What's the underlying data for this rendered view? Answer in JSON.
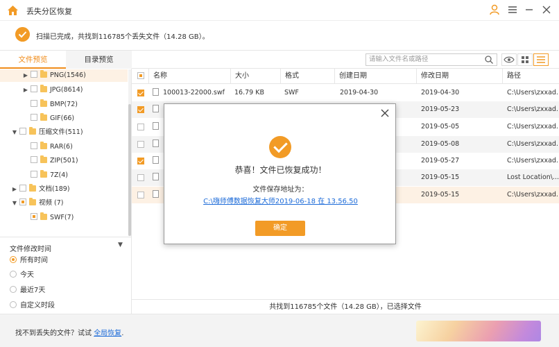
{
  "app": {
    "title": "丢失分区恢复",
    "icons": {
      "home": "home-icon",
      "user": "user-icon",
      "menu": "menu-icon",
      "minimize": "minimize-icon",
      "close": "close-icon"
    }
  },
  "status": {
    "message": "扫描已完成，共找到116785个丢失文件（14.28 GB）。"
  },
  "sidebar": {
    "tabs": [
      {
        "label": "文件预览",
        "active": true
      },
      {
        "label": "目录预览",
        "active": false
      }
    ],
    "tree": [
      {
        "label": "PNG(1546)",
        "level": 1,
        "arrow": "▶",
        "state": "none"
      },
      {
        "label": "JPG(8614)",
        "level": 1,
        "arrow": "▶",
        "state": "none"
      },
      {
        "label": "BMP(72)",
        "level": 1,
        "arrow": "",
        "state": "none"
      },
      {
        "label": "GIF(66)",
        "level": 1,
        "arrow": "",
        "state": "none"
      },
      {
        "label": "压缩文件(511)",
        "level": 0,
        "arrow": "▼",
        "state": "none"
      },
      {
        "label": "RAR(6)",
        "level": 1,
        "arrow": "",
        "state": "none"
      },
      {
        "label": "ZIP(501)",
        "level": 1,
        "arrow": "",
        "state": "none"
      },
      {
        "label": "7Z(4)",
        "level": 1,
        "arrow": "",
        "state": "none"
      },
      {
        "label": "文档(189)",
        "level": 0,
        "arrow": "▶",
        "state": "none"
      },
      {
        "label": "视频 (7)",
        "level": 0,
        "arrow": "▼",
        "state": "partial"
      },
      {
        "label": "SWF(7)",
        "level": 1,
        "arrow": "",
        "state": "partial"
      }
    ],
    "filter": {
      "title": "文件修改时间",
      "options": [
        {
          "label": "所有时间",
          "selected": true
        },
        {
          "label": "今天",
          "selected": false
        },
        {
          "label": "最近7天",
          "selected": false
        },
        {
          "label": "自定义时段",
          "selected": false
        }
      ]
    }
  },
  "main": {
    "search_placeholder": "请输入文件名或路径",
    "columns": [
      "名称",
      "大小",
      "格式",
      "创建日期",
      "修改日期",
      "路径"
    ],
    "rows": [
      {
        "checked": true,
        "name": "100013-22000.swf",
        "size": "16.79 KB",
        "format": "SWF",
        "created": "2019-04-30",
        "modified": "2019-04-30",
        "path": "C:\\Users\\zxxad..."
      },
      {
        "checked": true,
        "name": "",
        "size": "",
        "format": "",
        "created": "",
        "modified": "2019-05-23",
        "path": "C:\\Users\\zxxad..."
      },
      {
        "checked": false,
        "name": "",
        "size": "",
        "format": "",
        "created": "",
        "modified": "2019-05-05",
        "path": "C:\\Users\\zxxad..."
      },
      {
        "checked": false,
        "name": "",
        "size": "",
        "format": "",
        "created": "",
        "modified": "2019-05-08",
        "path": "C:\\Users\\zxxad..."
      },
      {
        "checked": true,
        "name": "",
        "size": "",
        "format": "",
        "created": "",
        "modified": "2019-05-27",
        "path": "C:\\Users\\zxxad..."
      },
      {
        "checked": false,
        "name": "",
        "size": "",
        "format": "",
        "created": "",
        "modified": "2019-05-15",
        "path": "Lost Location\\..."
      },
      {
        "checked": false,
        "name": "",
        "size": "",
        "format": "",
        "created": "",
        "modified": "2019-05-15",
        "path": "C:\\Users\\zxxad..."
      }
    ],
    "footer": "共找到116785个文件（14.28 GB），已选择文件"
  },
  "bottom": {
    "tip_prefix": "找不到丢失的文件？试试",
    "tip_link": "全局恢复",
    "tip_suffix": "."
  },
  "dialog": {
    "headline": "恭喜！文件已恢复成功！",
    "path_label": "文件保存地址为：",
    "path_link": "C:\\嗨师傅数据恢复大师2019-06-18 在 13.56.50",
    "ok_label": "确定"
  },
  "colors": {
    "accent": "#f29b26",
    "link": "#1b6ad8"
  }
}
